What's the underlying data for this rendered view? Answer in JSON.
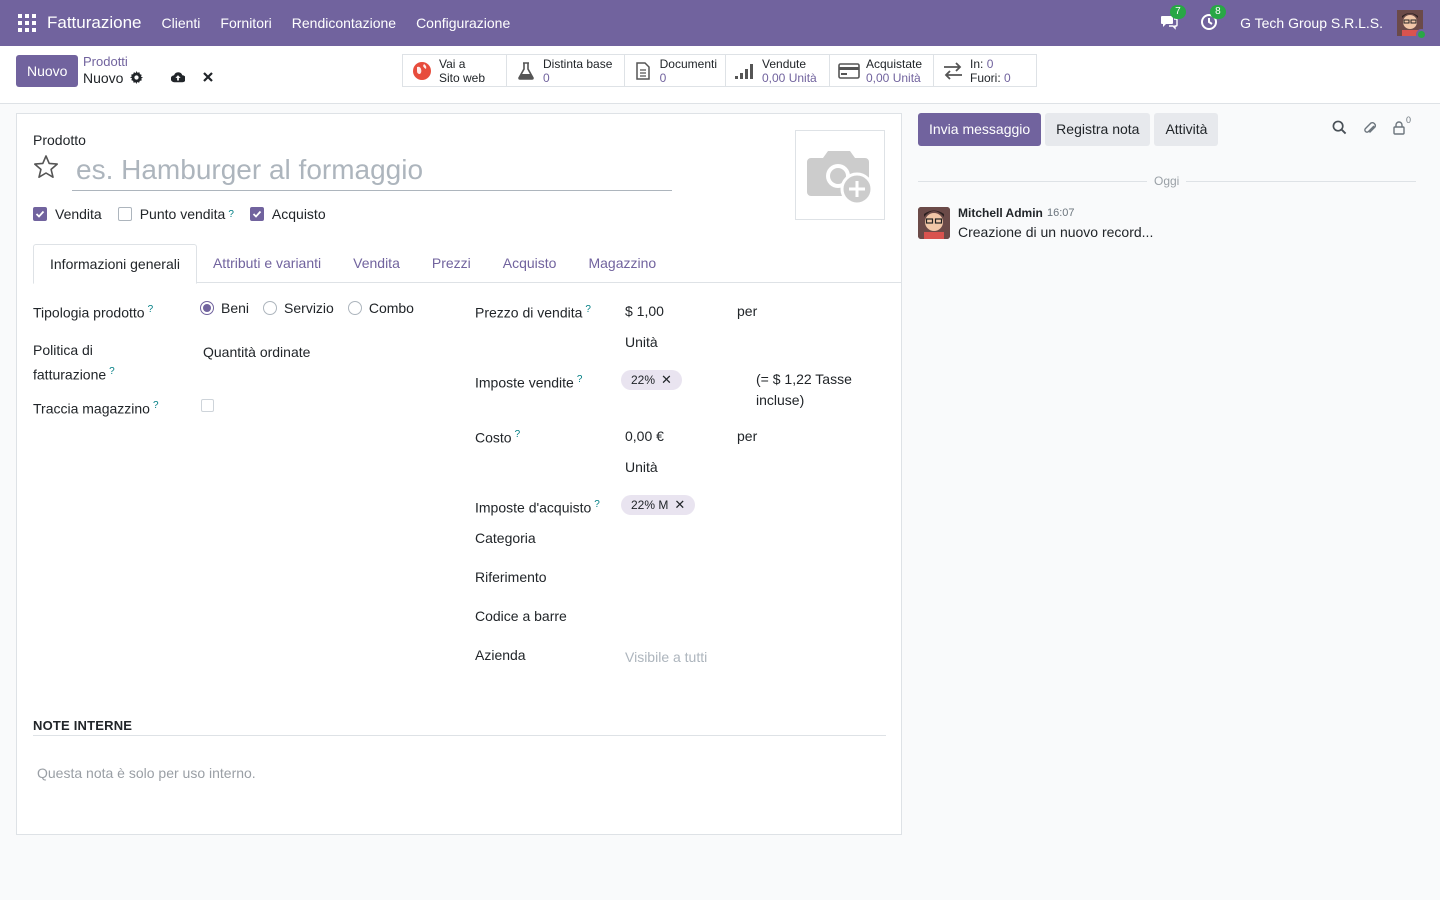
{
  "navbar": {
    "app_name": "Fatturazione",
    "menu": [
      "Clienti",
      "Fornitori",
      "Rendicontazione",
      "Configurazione"
    ],
    "messages_count": "7",
    "activities_count": "8",
    "company": "G Tech Group S.R.L.S."
  },
  "control": {
    "new_button": "Nuovo",
    "breadcrumb_parent": "Prodotti",
    "breadcrumb_current": "Nuovo"
  },
  "smart_buttons": [
    {
      "label": "Vai a",
      "value": "Sito web",
      "icon": "globe-icon"
    },
    {
      "label": "Distinta base",
      "value": "0",
      "icon": "flask-icon"
    },
    {
      "label": "Documenti",
      "value": "0",
      "icon": "document-icon"
    },
    {
      "label": "Vendute",
      "value": "0,00 Unità",
      "icon": "signal-icon"
    },
    {
      "label": "Acquistate",
      "value": "0,00 Unità",
      "icon": "credit-card-icon"
    },
    {
      "label_in": "In:",
      "value_in": "0",
      "label_out": "Fuori:",
      "value_out": "0",
      "icon": "exchange-icon"
    }
  ],
  "form": {
    "product_label": "Prodotto",
    "name_placeholder": "es. Hamburger al formaggio",
    "checks": [
      {
        "label": "Vendita",
        "checked": true,
        "help": ""
      },
      {
        "label": "Punto vendita",
        "checked": false,
        "help": "?"
      },
      {
        "label": "Acquisto",
        "checked": true,
        "help": ""
      }
    ],
    "tabs": [
      "Informazioni generali",
      "Attributi e varianti",
      "Vendita",
      "Prezzi",
      "Acquisto",
      "Magazzino"
    ],
    "left": {
      "product_type_label": "Tipologia prodotto",
      "product_type_options": [
        "Beni",
        "Servizio",
        "Combo"
      ],
      "invoice_policy_label_1": "Politica di",
      "invoice_policy_label_2": "fatturazione",
      "invoice_policy_value": "Quantità ordinate",
      "track_stock_label": "Traccia magazzino"
    },
    "right": {
      "sale_price_label": "Prezzo di vendita",
      "sale_price_value": "$ 1,00",
      "sale_per": "per",
      "sale_uom": "Unità",
      "sale_taxes_label": "Imposte vendite",
      "sale_tax_tag": "22%",
      "tax_included_1": "(= $ 1,22 Tasse",
      "tax_included_2": "incluse)",
      "cost_label": "Costo",
      "cost_value": "0,00 €",
      "cost_per": "per",
      "cost_uom": "Unità",
      "purchase_taxes_label": "Imposte d'acquisto",
      "purchase_tax_tag": "22% M",
      "category_label": "Categoria",
      "reference_label": "Riferimento",
      "barcode_label": "Codice a barre",
      "company_label": "Azienda",
      "company_placeholder": "Visibile a tutti"
    },
    "notes_title": "NOTE INTERNE",
    "notes_placeholder": "Questa nota è solo per uso interno."
  },
  "chatter": {
    "send_message": "Invia messaggio",
    "log_note": "Registra nota",
    "activities": "Attività",
    "followers_count": "0",
    "today": "Oggi",
    "message": {
      "author": "Mitchell Admin",
      "time": "16:07",
      "body": "Creazione di un nuovo record..."
    }
  },
  "colors": {
    "primary": "#71639e",
    "badge": "#28a745",
    "help": "#017e84"
  }
}
